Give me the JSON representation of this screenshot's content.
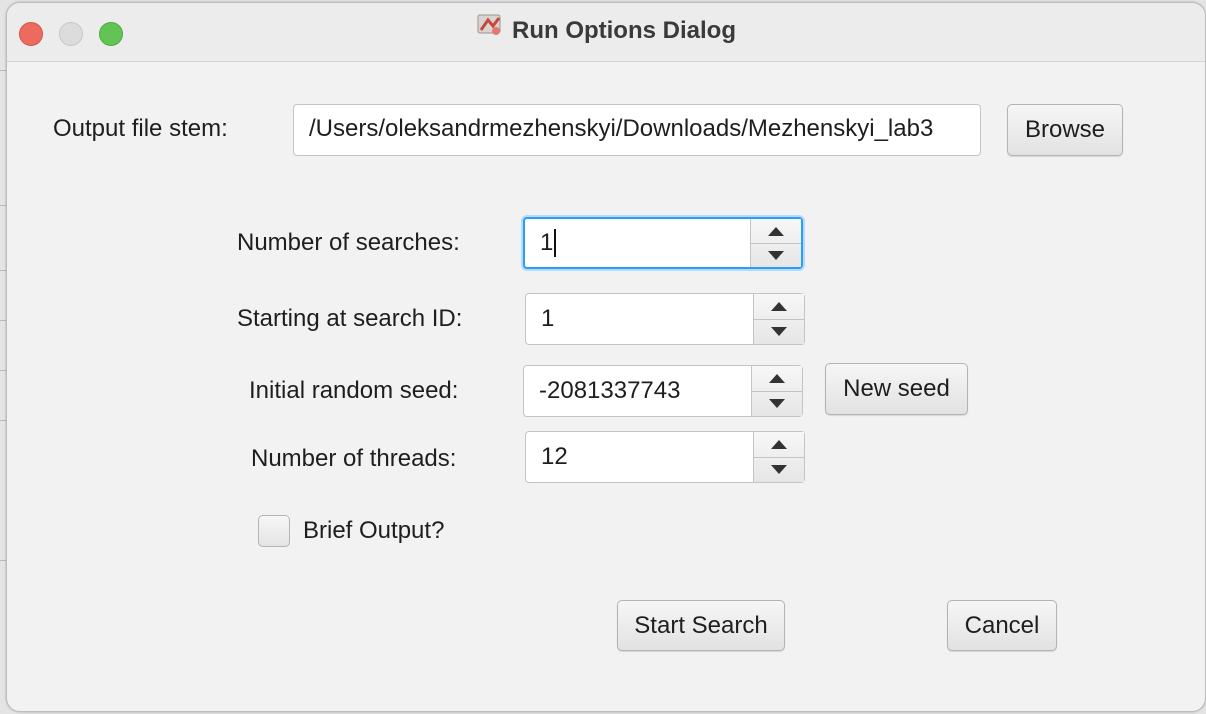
{
  "window": {
    "title": "Run Options Dialog",
    "icon": "app-icon"
  },
  "output_file": {
    "label": "Output file stem:",
    "value": "/Users/oleksandrmezhenskyi/Downloads/Mezhenskyi_lab3",
    "browse_label": "Browse"
  },
  "fields": {
    "num_searches": {
      "label": "Number of searches:",
      "value": "1"
    },
    "start_id": {
      "label": "Starting at search ID:",
      "value": "1"
    },
    "seed": {
      "label": "Initial random seed:",
      "value": "-2081337743",
      "new_seed_label": "New seed"
    },
    "threads": {
      "label": "Number of threads:",
      "value": "12"
    }
  },
  "brief_output": {
    "label": "Brief Output?",
    "checked": false
  },
  "actions": {
    "start_label": "Start Search",
    "cancel_label": "Cancel"
  },
  "colors": {
    "focus": "#2a9df4",
    "close": "#ed6a5e",
    "maximize": "#61c454"
  }
}
